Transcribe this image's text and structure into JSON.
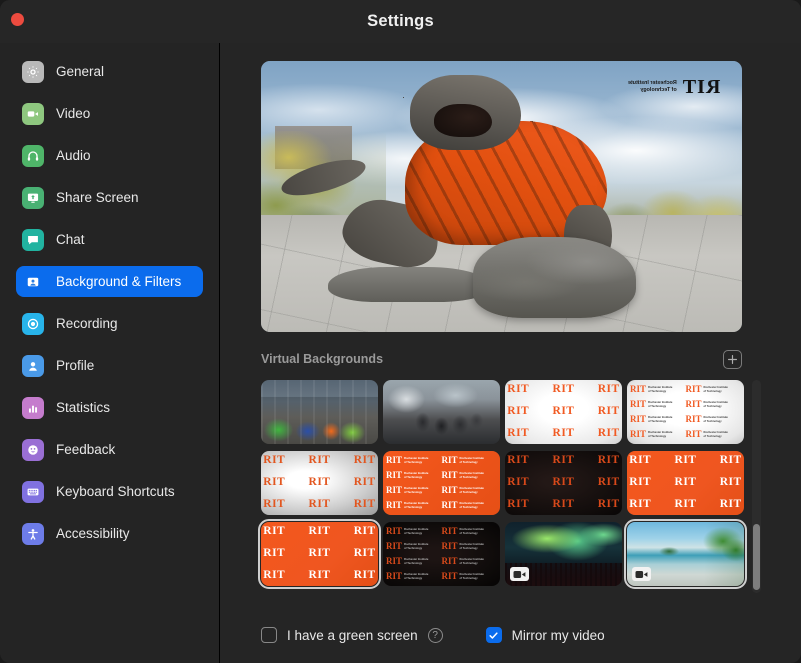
{
  "window": {
    "title": "Settings",
    "traffic_lights": [
      "close"
    ]
  },
  "colors": {
    "accent": "#0b6ced",
    "window_bg": "#252525",
    "sidebar_bg": "#242424",
    "rit_orange": "#f15a22",
    "section_label": "#9a9a9a"
  },
  "sidebar": {
    "items": [
      {
        "label": "General",
        "icon": "gear-icon",
        "icon_color": "#b9b9b9",
        "active": false
      },
      {
        "label": "Video",
        "icon": "video-camera-icon",
        "icon_color": "#8ec77f",
        "active": false
      },
      {
        "label": "Audio",
        "icon": "headphones-icon",
        "icon_color": "#4fb569",
        "active": false
      },
      {
        "label": "Share Screen",
        "icon": "share-screen-icon",
        "icon_color": "#49b173",
        "active": false
      },
      {
        "label": "Chat",
        "icon": "chat-bubble-icon",
        "icon_color": "#21b3a0",
        "active": false
      },
      {
        "label": "Background & Filters",
        "icon": "person-card-icon",
        "icon_color": "#2a7de1",
        "active": true
      },
      {
        "label": "Recording",
        "icon": "record-circle-icon",
        "icon_color": "#28b4ea",
        "active": false
      },
      {
        "label": "Profile",
        "icon": "person-icon",
        "icon_color": "#4a9ae8",
        "active": false
      },
      {
        "label": "Statistics",
        "icon": "bar-chart-icon",
        "icon_color": "#c57ccd",
        "active": false
      },
      {
        "label": "Feedback",
        "icon": "smiley-face-icon",
        "icon_color": "#9a6fd4",
        "active": false
      },
      {
        "label": "Keyboard Shortcuts",
        "icon": "keyboard-icon",
        "icon_color": "#8071e0",
        "active": false
      },
      {
        "label": "Accessibility",
        "icon": "accessibility-icon",
        "icon_color": "#6d7ce8",
        "active": false
      }
    ]
  },
  "preview": {
    "description": "RIT Tiger statue wearing an orange knit sweater on stone rocks",
    "mirrored": true,
    "watermark": {
      "rit": "RIT",
      "line1": "Rochester Institute",
      "line2": "of Technology"
    }
  },
  "virtual_backgrounds": {
    "section_title": "Virtual Backgrounds",
    "add_button_icon": "plus-icon",
    "scrollbar": {
      "visible": true,
      "thumb_position": "bottom"
    },
    "thumbnails": [
      {
        "name": "rit-lounge-photo",
        "kind": "photo",
        "style": "ph-lounge",
        "selected": false,
        "video": false
      },
      {
        "name": "rit-classroom-photo",
        "kind": "photo",
        "style": "ph-class",
        "selected": false,
        "video": false
      },
      {
        "name": "rit-white-orange-text",
        "kind": "pattern",
        "style": "bg-white-orange",
        "selected": false,
        "video": false
      },
      {
        "name": "rit-white-logo-lockup",
        "kind": "lockup",
        "style": "bg-lock-white",
        "selected": false,
        "video": false
      },
      {
        "name": "rit-grey-orange-text",
        "kind": "pattern",
        "style": "bg-grey-orange",
        "selected": false,
        "video": false
      },
      {
        "name": "rit-orange-logo-lockup",
        "kind": "lockup",
        "style": "bg-lock-orange",
        "selected": false,
        "video": false
      },
      {
        "name": "rit-black-orange-text",
        "kind": "pattern",
        "style": "bg-black-orange",
        "selected": false,
        "video": false
      },
      {
        "name": "rit-orange-white-text",
        "kind": "pattern",
        "style": "bg-orange-white",
        "selected": false,
        "video": false
      },
      {
        "name": "rit-orange-white-text-2",
        "kind": "pattern",
        "style": "bg-orange-white",
        "selected": true,
        "video": false
      },
      {
        "name": "rit-black-logo-lockup",
        "kind": "lockup",
        "style": "bg-lock-black",
        "selected": false,
        "video": false
      },
      {
        "name": "aurora-borealis-video",
        "kind": "photo",
        "style": "ph-aurora",
        "selected": false,
        "video": true
      },
      {
        "name": "tropical-beach-video",
        "kind": "photo",
        "style": "ph-beach",
        "selected": true,
        "video": true
      }
    ],
    "pattern_word": "RIT",
    "lockup": {
      "rit": "RIT",
      "line1": "Rochester Institute",
      "line2": "of Technology"
    }
  },
  "options": {
    "green_screen": {
      "label": "I have a green screen",
      "checked": false,
      "help_icon": "question-mark-icon",
      "help_glyph": "?"
    },
    "mirror_video": {
      "label": "Mirror my video",
      "checked": true
    }
  }
}
